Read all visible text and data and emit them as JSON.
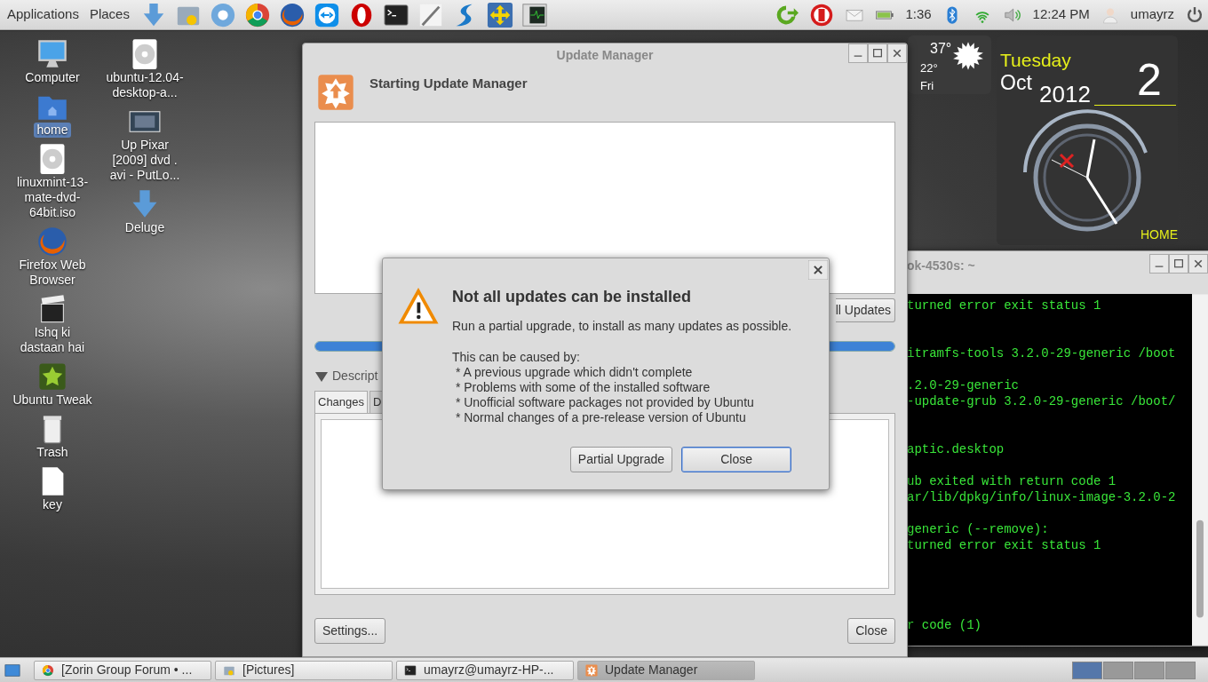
{
  "top_panel": {
    "menus": [
      "Applications",
      "Places"
    ],
    "launchers": [
      {
        "kind": "download"
      },
      {
        "kind": "files"
      },
      {
        "kind": "chromium"
      },
      {
        "kind": "chrome"
      },
      {
        "kind": "firefox"
      },
      {
        "kind": "remote"
      },
      {
        "kind": "opera"
      },
      {
        "kind": "terminal"
      },
      {
        "kind": "pen"
      },
      {
        "kind": "swirl"
      },
      {
        "kind": "arrows"
      },
      {
        "kind": "monitor"
      }
    ],
    "tray": [
      {
        "kind": "refresh"
      },
      {
        "kind": "stop"
      },
      {
        "kind": "mail"
      },
      {
        "kind": "battery"
      },
      {
        "kind": "text",
        "text": "1:36"
      },
      {
        "kind": "bluetooth"
      },
      {
        "kind": "wifi"
      },
      {
        "kind": "volume"
      },
      {
        "kind": "text",
        "text": "12:24 PM"
      },
      {
        "kind": "user"
      },
      {
        "kind": "text",
        "text": "umayrz"
      },
      {
        "kind": "power"
      }
    ]
  },
  "desktop_icons": [
    [
      {
        "kind": "computer",
        "label": "Computer",
        "selected": false
      },
      {
        "kind": "folder",
        "label": "home",
        "selected": true
      },
      {
        "kind": "disc",
        "label": "linuxmint-13-mate-dvd-64bit.iso",
        "selected": false
      },
      {
        "kind": "firefox",
        "label": "Firefox Web Browser",
        "selected": false
      },
      {
        "kind": "clapper",
        "label": "Ishq ki dastaan hai",
        "selected": false
      },
      {
        "kind": "tweak",
        "label": "Ubuntu Tweak",
        "selected": false
      },
      {
        "kind": "trash",
        "label": "Trash",
        "selected": false
      },
      {
        "kind": "file",
        "label": "key",
        "selected": false
      }
    ],
    [
      {
        "kind": "disc",
        "label": "ubuntu-12.04-desktop-a...",
        "selected": false
      },
      {
        "kind": "video",
        "label": "Up Pixar [2009] dvd . avi - PutLo...",
        "selected": false
      },
      {
        "kind": "download",
        "label": "Deluge",
        "selected": false
      }
    ]
  ],
  "weather": {
    "high": "37°",
    "low": "22°",
    "day": "Fri"
  },
  "calendar": {
    "weekday": "Tuesday",
    "month": "Oct",
    "year": "2012",
    "day": "2",
    "location": "HOME"
  },
  "update_manager": {
    "title": "Update Manager",
    "heading": "Starting Update Manager",
    "install_button": "ll Updates",
    "progress": {
      "level": 1.0
    },
    "expander": {
      "label": "Descript",
      "expanded": true
    },
    "tabs": [
      {
        "label": "Changes",
        "selected": true
      },
      {
        "label": "D",
        "selected": false
      }
    ],
    "buttons": [
      "Settings...",
      "Close"
    ]
  },
  "dialog": {
    "title": "Not all updates can be installed",
    "message": "Run a partial upgrade, to install as many updates as possible.",
    "causes_intro": "This can be caused by:",
    "causes": [
      " * A previous upgrade which didn't complete",
      " * Problems with some of the installed software",
      " * Unofficial software packages not provided by Ubuntu",
      " * Normal changes of a pre-release version of Ubuntu"
    ],
    "buttons": [
      {
        "label": "Partial Upgrade",
        "default": false
      },
      {
        "label": "Close",
        "default": true
      }
    ]
  },
  "terminal": {
    "title": "ok-4530s: ~",
    "lines": [
      {
        "kind": "text",
        "text": "turned error exit status 1"
      },
      {
        "kind": "blank"
      },
      {
        "kind": "blank"
      },
      {
        "kind": "text",
        "text": "itramfs-tools 3.2.0-29-generic /boot"
      },
      {
        "kind": "blank"
      },
      {
        "kind": "text",
        "text": ".2.0-29-generic"
      },
      {
        "kind": "text",
        "text": "-update-grub 3.2.0-29-generic /boot/"
      },
      {
        "kind": "blank"
      },
      {
        "kind": "blank"
      },
      {
        "kind": "text",
        "text": "aptic.desktop"
      },
      {
        "kind": "blank"
      },
      {
        "kind": "text",
        "text": "ub exited with return code 1"
      },
      {
        "kind": "text",
        "text": "ar/lib/dpkg/info/linux-image-3.2.0-2"
      },
      {
        "kind": "blank"
      },
      {
        "kind": "text",
        "text": "generic (--remove):"
      },
      {
        "kind": "text",
        "text": "turned error exit status 1"
      },
      {
        "kind": "blank"
      },
      {
        "kind": "blank"
      },
      {
        "kind": "blank"
      },
      {
        "kind": "blank"
      },
      {
        "kind": "text",
        "text": "r code (1)"
      }
    ]
  },
  "taskbar": {
    "tasks": [
      {
        "kind": "chrome",
        "label": "[Zorin Group Forum • ...",
        "selected": false
      },
      {
        "kind": "files",
        "label": "[Pictures]",
        "selected": false
      },
      {
        "kind": "terminal",
        "label": "umayrz@umayrz-HP-...",
        "selected": false
      },
      {
        "kind": "update",
        "label": "Update Manager",
        "selected": true
      }
    ],
    "workspaces": [
      {
        "selected": true
      },
      {
        "selected": false
      },
      {
        "selected": false
      },
      {
        "selected": false
      }
    ]
  }
}
